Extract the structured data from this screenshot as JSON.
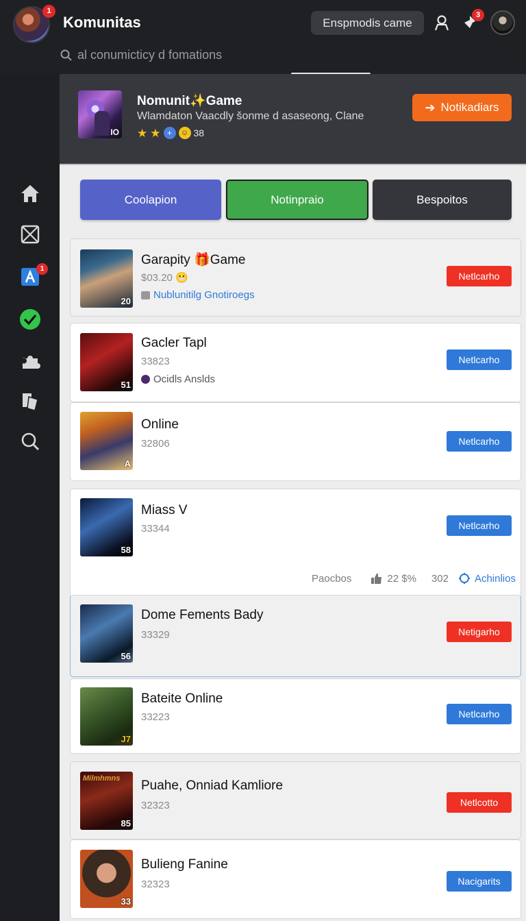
{
  "header": {
    "title": "Komunitas",
    "avatar_badge": "1",
    "pill_label": "Enspmodis came",
    "notif_badge": "3",
    "search_placeholder": "al conumicticy d fomations",
    "icons": {
      "search": "search-icon",
      "profile": "user-icon",
      "notifications": "pin-icon"
    }
  },
  "sidebar": {
    "items": [
      {
        "icon": "home-icon"
      },
      {
        "icon": "envelope-box-icon"
      },
      {
        "icon": "app-icon",
        "badge": "1"
      },
      {
        "icon": "check-circle-icon"
      },
      {
        "icon": "puzzle-icon"
      },
      {
        "icon": "cards-icon"
      },
      {
        "icon": "search-icon"
      }
    ]
  },
  "feature": {
    "thumb_tag": "IO",
    "title": "Nomunit✨Game",
    "subtitle": "Wlamdaton Vaacdly šonme d asaseong, Clane",
    "rating_count": "38",
    "button_label": "Notikadiars"
  },
  "tabs": [
    {
      "label": "Coolapion",
      "color": "#5563c8"
    },
    {
      "label": "Notinpraio",
      "color": "#3fa84b"
    },
    {
      "label": "Bespoitos",
      "color": "#34363c"
    }
  ],
  "games": [
    {
      "title": "Garapity 🎁Game",
      "price": "$03.20 😬",
      "extra": "Nublunitilg Gnotiroegs",
      "status": "Netlcarho",
      "status_color": "red",
      "thumb_num": "20"
    },
    {
      "title": "Gacler Tapl",
      "price": "33823",
      "extra": "Ocidls Anslds",
      "status": "Netlcarho",
      "status_color": "blue",
      "thumb_num": "51"
    },
    {
      "title": "Online",
      "price": "32806",
      "status": "Netlcarho",
      "status_color": "blue",
      "thumb_num": "A"
    },
    {
      "title": "Miass V",
      "price": "33344",
      "status": "Netlcarho",
      "status_color": "blue",
      "thumb_num": "58",
      "meta": {
        "label": "Paocbos",
        "likes": "22 $%",
        "count": "302",
        "link": "Achinlios"
      }
    },
    {
      "title": "Dome Fements Bady",
      "price": "33329",
      "status": "Netigarho",
      "status_color": "red",
      "thumb_num": "56"
    },
    {
      "title": "Bateite Online",
      "price": "33223",
      "status": "Netlcarho",
      "status_color": "blue",
      "thumb_num": "J7"
    },
    {
      "title": "Puahe, Onniad Kamliore",
      "price": "32323",
      "status": "Netlcotto",
      "status_color": "red",
      "thumb_num": "85",
      "thumb_text": "Milmhmns"
    },
    {
      "title": "Bulieng Fanine",
      "price": "32323",
      "status": "Nacigarits",
      "status_color": "blue",
      "thumb_num": "33"
    }
  ]
}
